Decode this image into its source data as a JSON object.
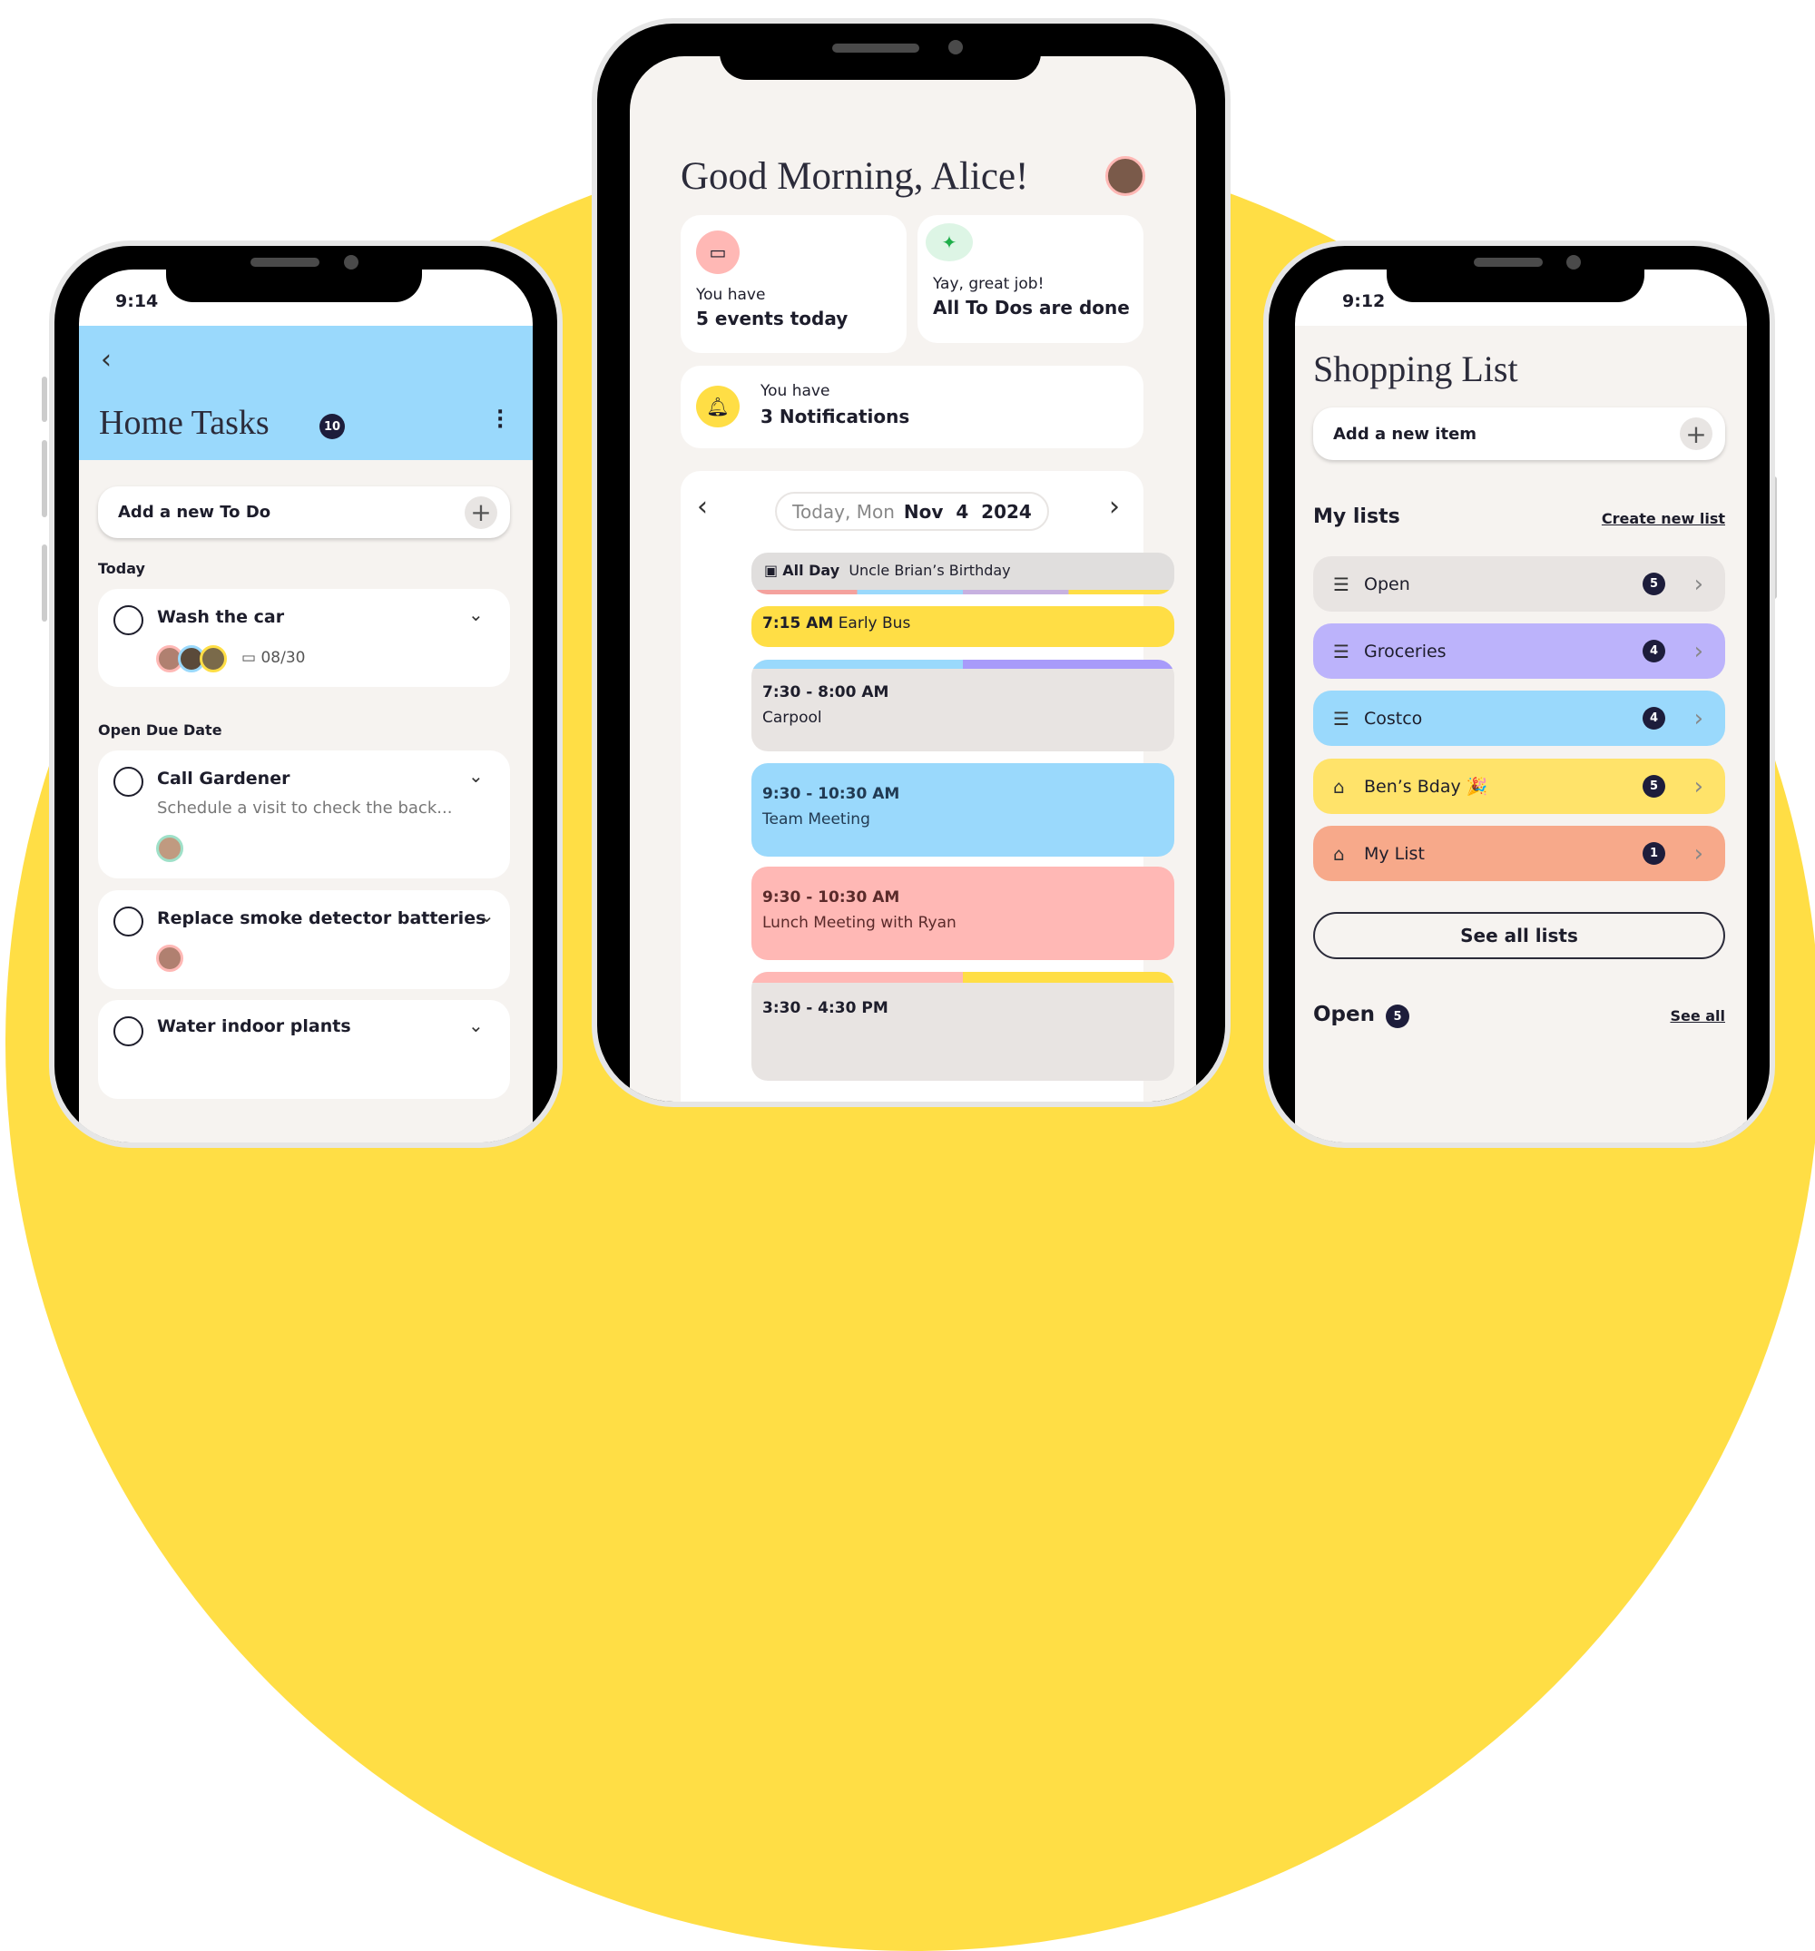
{
  "colors": {
    "yellow": "#FFDE45",
    "blue": "#9AD9FC",
    "purple": "#BCB3FB",
    "pink": "#FFB8B5",
    "salmon": "#F7A98A",
    "gray": "#E8E4E2",
    "navy": "#1d1d3b"
  },
  "left": {
    "time": "9:14",
    "back_icon": "chevron-left",
    "title": "Home Tasks",
    "count": "10",
    "add_placeholder": "Add a new To Do",
    "sections": [
      {
        "label": "Today"
      },
      {
        "label": "Open Due Date"
      }
    ],
    "tasks": [
      {
        "title": "Wash the car",
        "date": "08/30"
      },
      {
        "title": "Call Gardener",
        "subtitle": "Schedule a visit to check the back..."
      },
      {
        "title": "Replace smoke detector batteries"
      },
      {
        "title": "Water indoor plants"
      }
    ]
  },
  "center": {
    "greeting": "Good Morning, Alice!",
    "events_card": {
      "line1": "You have",
      "line2": "5 events today"
    },
    "todos_card": {
      "line1": "Yay, great job!",
      "line2": "All To Dos are done"
    },
    "notif_card": {
      "line1": "You have",
      "line2": "3 Notifications"
    },
    "date": {
      "prefix": "Today, Mon",
      "date": "Nov  4  2024"
    },
    "events": [
      {
        "time": "All Day",
        "title": "Uncle Brian’s Birthday"
      },
      {
        "time": "7:15 AM",
        "title": "Early Bus"
      },
      {
        "time": "7:30 - 8:00 AM",
        "title": "Carpool"
      },
      {
        "time": "9:30 - 10:30 AM",
        "title": "Team Meeting"
      },
      {
        "time": "9:30 - 10:30 AM",
        "title": "Lunch Meeting with Ryan"
      },
      {
        "time": "3:30 - 4:30 PM"
      }
    ]
  },
  "right": {
    "time": "9:12",
    "title": "Shopping List",
    "add_placeholder": "Add a new item",
    "my_lists": "My lists",
    "create_link": "Create new list",
    "lists": [
      {
        "name": "Open",
        "count": "5"
      },
      {
        "name": "Groceries",
        "count": "4"
      },
      {
        "name": "Costco",
        "count": "4"
      },
      {
        "name": "Ben’s Bday 🎉",
        "count": "5"
      },
      {
        "name": "My List",
        "count": "1"
      }
    ],
    "see_all_lists": "See all lists",
    "open_label": "Open",
    "open_count": "5",
    "see_all": "See all"
  }
}
